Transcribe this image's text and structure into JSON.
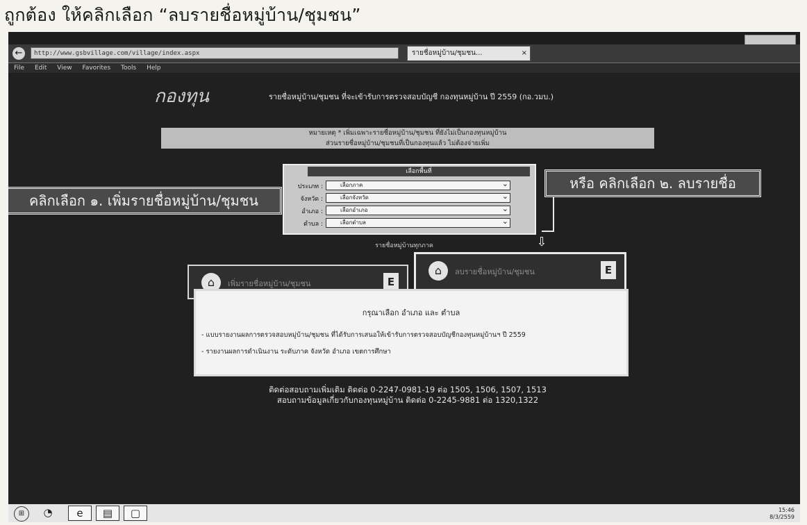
{
  "caption": "ถูกต้อง ให้คลิกเลือก “ลบรายชื่อหมู่บ้าน/ชุมชน”",
  "browser": {
    "address": "http://www.gsbvillage.com/village/index.aspx",
    "tab_label": "รายชื่อหมู่บ้าน/ชุมชน...",
    "menu": [
      "File",
      "Edit",
      "View",
      "Favorites",
      "Tools",
      "Help"
    ]
  },
  "page": {
    "logo_text": "กองทุน",
    "title": "รายชื่อหมู่บ้าน/ชุมชน ที่จะเข้ารับการตรวจสอบบัญชี กองทุนหมู่บ้าน ปี 2559 (กอ.วมบ.)",
    "notice_line1": "หมายเหตุ * เพิ่มเฉพาะรายชื่อหมู่บ้าน/ชุมชน ที่ยังไม่เป็นกองทุนหมู่บ้าน",
    "notice_line2": "ส่วนรายชื่อหมู่บ้าน/ชุมชนที่เป็นกองทุนแล้ว ไม่ต้องจ่ายเพิ่ม",
    "banner": "รายชื่อหมู่บ้านทุกภาค",
    "panel_header": "เลือกพื้นที่",
    "rows": [
      {
        "label": "ประเภท :",
        "value": "เลือกภาค"
      },
      {
        "label": "จังหวัด :",
        "value": "เลือกจังหวัด"
      },
      {
        "label": "อำเภอ :",
        "value": "เลือกอำเภอ"
      },
      {
        "label": "ตำบล :",
        "value": "เลือกตำบล"
      }
    ],
    "callout_left": "คลิกเลือก ๑. เพิ่มรายชื่อหมู่บ้าน/ชุมชน",
    "callout_right": "หรือ คลิกเลือก ๒. ลบรายชื่อ",
    "btn_add": "เพิ่มรายชื่อหมู่บ้าน/ชุมชน",
    "btn_delete": "ลบรายชื่อหมู่บ้าน/ชุมชน",
    "info_title": "กรุณาเลือก อำเภอ และ ตำบล",
    "info_item1": "- แบบรายงานผลการตรวจสอบหมู่บ้าน/ชุมชน ที่ได้รับการเสนอให้เข้ารับการตรวจสอบบัญชีกองทุนหมู่บ้านฯ ปี 2559",
    "info_item2": "- รายงานผลการดำเนินงาน ระดับภาค จังหวัด อำเภอ เขตการศึกษา",
    "contact_line1": "ติดต่อสอบถามเพิ่มเติม ติดต่อ 0-2247-0981-19 ต่อ 1505, 1506, 1507, 1513",
    "contact_line2": "สอบถามข้อมูลเกี่ยวกับกองทุนหมู่บ้าน ติดต่อ 0-2245-9881 ต่อ 1320,1322"
  },
  "taskbar": {
    "clock_time": "15:46",
    "clock_date": "8/3/2559"
  }
}
